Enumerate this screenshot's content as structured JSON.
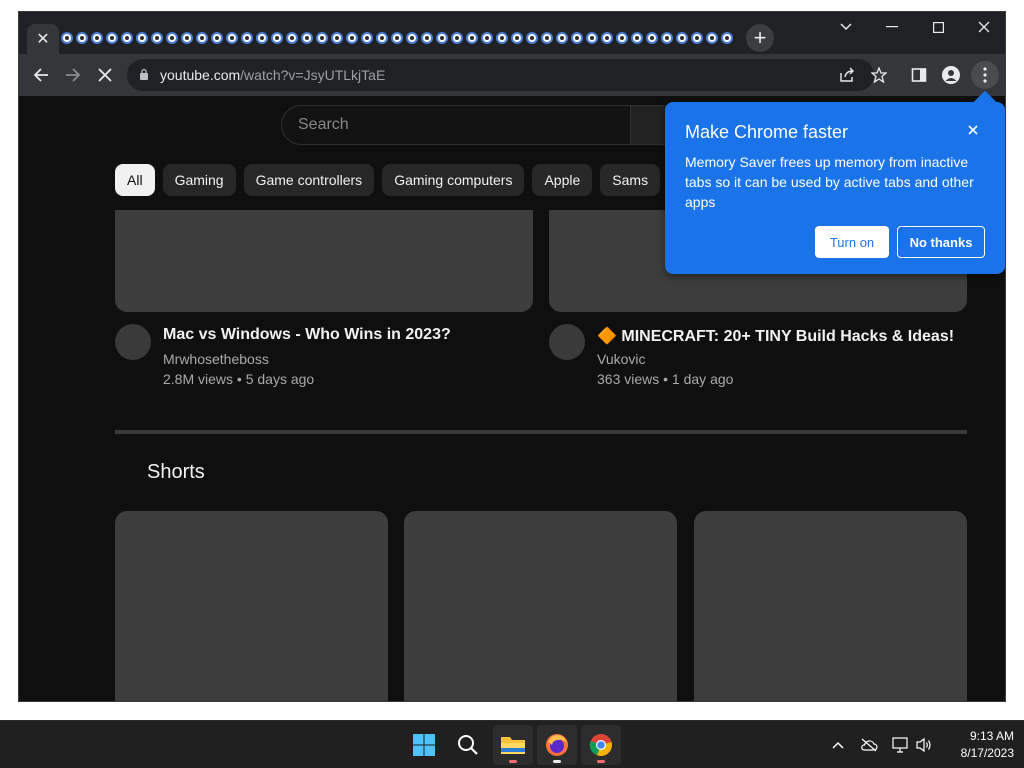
{
  "browser": {
    "active_tab_close": "✕",
    "new_tab_label": "+",
    "url_domain": "youtube.com",
    "url_path": "/watch?v=JsyUTLkjTaE",
    "window_controls": [
      "⌄",
      "—",
      "☐",
      "✕"
    ]
  },
  "youtube": {
    "search_placeholder": "Search",
    "chips": [
      "All",
      "Gaming",
      "Game controllers",
      "Gaming computers",
      "Apple",
      "Sams"
    ],
    "videos": [
      {
        "title": "Mac vs Windows - Who Wins in 2023?",
        "channel": "Mrwhosetheboss",
        "stats": "2.8M views • 5 days ago"
      },
      {
        "title": "🔶 MINECRAFT: 20+ TINY Build Hacks & Ideas!",
        "channel": "Vukovic",
        "stats": "363 views • 1 day ago"
      }
    ],
    "shorts_title": "Shorts"
  },
  "popup": {
    "title": "Make Chrome faster",
    "body": "Memory Saver frees up memory from inactive tabs so it can be used by active tabs and other apps",
    "turn_on": "Turn on",
    "no_thanks": "No thanks",
    "close": "✕"
  },
  "taskbar": {
    "time": "9:13 AM",
    "date": "8/17/2023"
  },
  "colors": {
    "accent": "#1a73e8",
    "page_bg": "#0f0f0f"
  }
}
